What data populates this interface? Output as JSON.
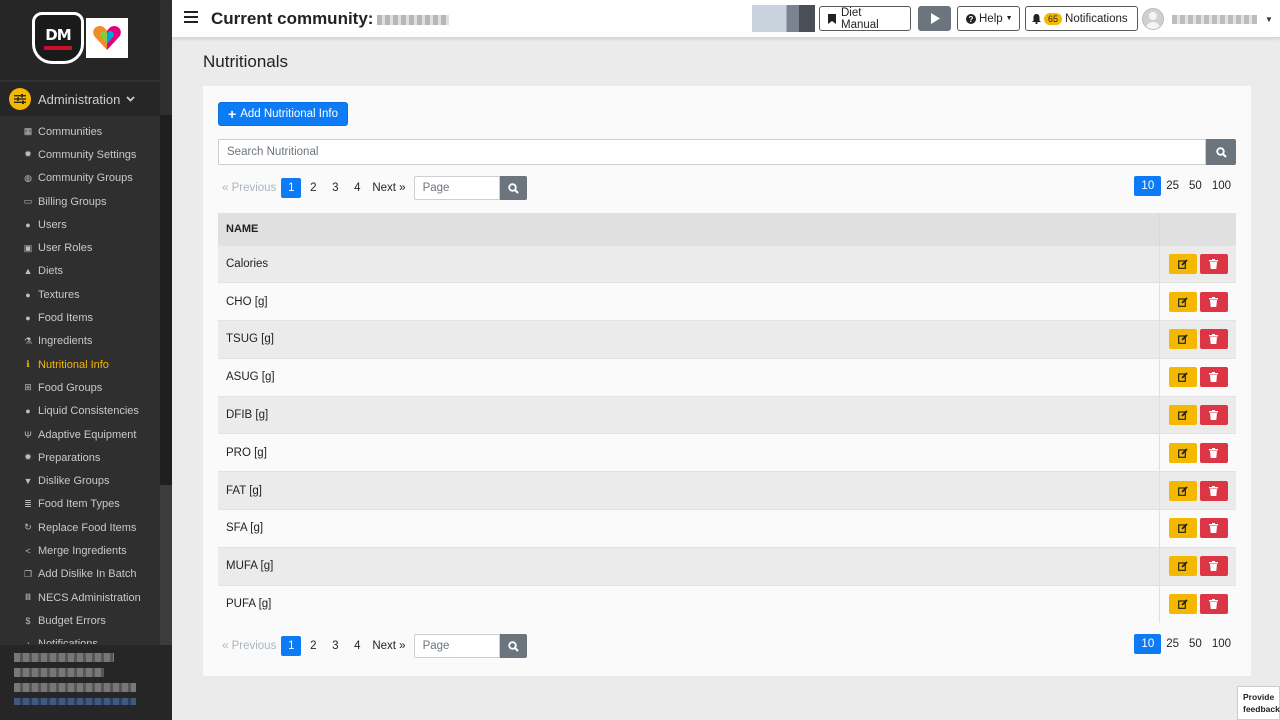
{
  "sidebar": {
    "section_label": "Administration",
    "items": [
      {
        "label": "Communities",
        "icon": "building-icon",
        "glyph": "▦"
      },
      {
        "label": "Community Settings",
        "icon": "gear-icon",
        "glyph": "✹"
      },
      {
        "label": "Community Groups",
        "icon": "globe-icon",
        "glyph": "◍"
      },
      {
        "label": "Billing Groups",
        "icon": "money-icon",
        "glyph": "▭"
      },
      {
        "label": "Users",
        "icon": "users-icon",
        "glyph": "●"
      },
      {
        "label": "User Roles",
        "icon": "lock-icon",
        "glyph": "▣"
      },
      {
        "label": "Diets",
        "icon": "warning-icon",
        "glyph": "▲"
      },
      {
        "label": "Textures",
        "icon": "droplet-icon",
        "glyph": "●"
      },
      {
        "label": "Food Items",
        "icon": "apple-icon",
        "glyph": "●"
      },
      {
        "label": "Ingredients",
        "icon": "flask-icon",
        "glyph": "⚗"
      },
      {
        "label": "Nutritional Info",
        "icon": "info-icon",
        "glyph": "ℹ",
        "active": true
      },
      {
        "label": "Food Groups",
        "icon": "sitemap-icon",
        "glyph": "⊞"
      },
      {
        "label": "Liquid Consistencies",
        "icon": "droplet-icon",
        "glyph": "●"
      },
      {
        "label": "Adaptive Equipment",
        "icon": "utensils-icon",
        "glyph": "Ψ"
      },
      {
        "label": "Preparations",
        "icon": "cogs-icon",
        "glyph": "✹"
      },
      {
        "label": "Dislike Groups",
        "icon": "thumbs-down-icon",
        "glyph": "▼"
      },
      {
        "label": "Food Item Types",
        "icon": "list-icon",
        "glyph": "≣"
      },
      {
        "label": "Replace Food Items",
        "icon": "sync-icon",
        "glyph": "↻"
      },
      {
        "label": "Merge Ingredients",
        "icon": "share-icon",
        "glyph": "<"
      },
      {
        "label": "Add Dislike In Batch",
        "icon": "copy-icon",
        "glyph": "❐"
      },
      {
        "label": "NECS Administration",
        "icon": "bank-icon",
        "glyph": "Ⅲ"
      },
      {
        "label": "Budget Errors",
        "icon": "dollar-icon",
        "glyph": "$"
      },
      {
        "label": "Notifications",
        "icon": "bell-icon",
        "glyph": "♪"
      }
    ]
  },
  "topbar": {
    "community_label": "Current community:",
    "diet_manual": "Diet Manual",
    "help": "Help",
    "notifications_count": "65",
    "notifications": "Notifications"
  },
  "page": {
    "title": "Nutritionals",
    "add_button": "Add Nutritional Info",
    "search_placeholder": "Search Nutritional"
  },
  "pagination": {
    "previous": "« Previous",
    "pages": [
      "1",
      "2",
      "3",
      "4"
    ],
    "active_page": "1",
    "next": "Next »",
    "page_placeholder": "Page",
    "per_page": [
      "10",
      "25",
      "50",
      "100"
    ],
    "active_per_page": "10"
  },
  "table": {
    "column_name": "NAME",
    "rows": [
      "Calories",
      "CHO [g]",
      "TSUG [g]",
      "ASUG [g]",
      "DFIB [g]",
      "PRO [g]",
      "FAT [g]",
      "SFA [g]",
      "MUFA [g]",
      "PUFA [g]"
    ]
  },
  "feedback": {
    "line1": "Provide",
    "line2": "feedback"
  },
  "colors": {
    "primary": "#0d7bf5",
    "warning": "#f5b800",
    "danger": "#dc3545",
    "secondary": "#6c757d"
  }
}
